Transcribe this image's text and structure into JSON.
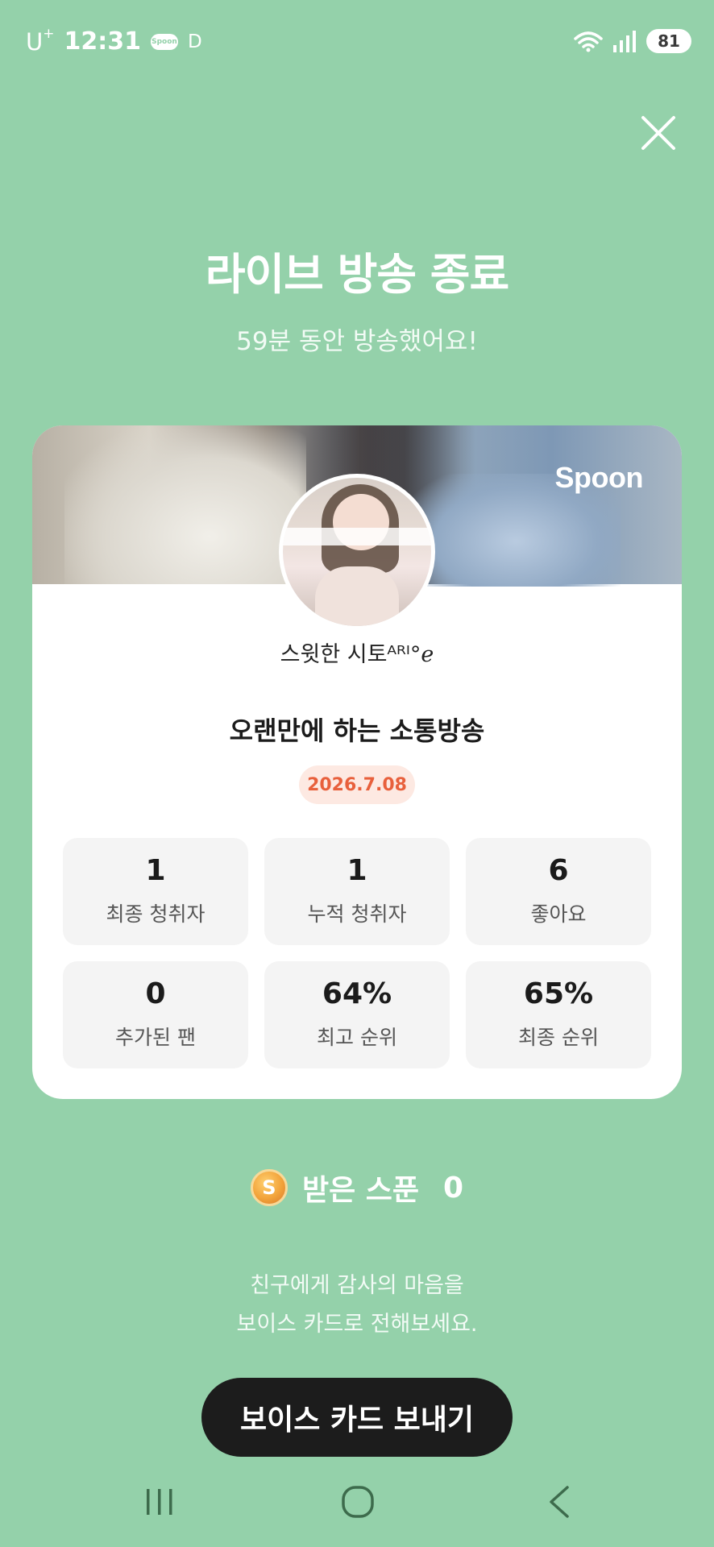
{
  "status_bar": {
    "carrier": "U",
    "carrier_sup": "+",
    "time": "12:31",
    "app_badge": "Spoon",
    "indicator": "D",
    "battery": "81",
    "icons": [
      "wifi-icon",
      "signal-icon",
      "battery-icon"
    ]
  },
  "header": {
    "title": "라이브 방송 종료",
    "subtitle": "59분 동안 방송했어요!"
  },
  "card": {
    "brand": "Spoon",
    "nickname": "스윗한 시토ᴬᴿᴵ°ℯ",
    "broadcast_title": "오랜만에 하는 소통방송",
    "date": "2026.7.08",
    "stats": [
      {
        "value": "1",
        "label": "최종 청취자"
      },
      {
        "value": "1",
        "label": "누적 청취자"
      },
      {
        "value": "6",
        "label": "좋아요"
      },
      {
        "value": "0",
        "label": "추가된 팬"
      },
      {
        "value": "64%",
        "label": "최고 순위"
      },
      {
        "value": "65%",
        "label": "최종 순위"
      }
    ]
  },
  "received": {
    "coin_letter": "S",
    "label": "받은 스푼",
    "count": "0"
  },
  "message": {
    "line1": "친구에게 감사의 마음을",
    "line2": "보이스 카드로 전해보세요."
  },
  "voice_button": {
    "label": "보이스 카드 보내기"
  },
  "colors": {
    "background": "#94d1aa",
    "date_badge_bg": "#fde9e2",
    "date_badge_text": "#e8603c",
    "button_bg": "#1c1c1c"
  }
}
